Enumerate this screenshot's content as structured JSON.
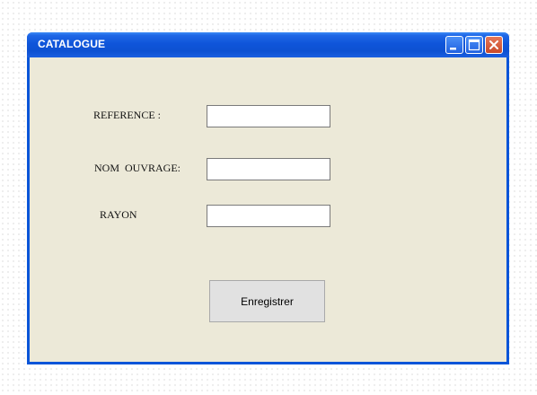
{
  "window": {
    "title": "CATALOGUE",
    "controls": {
      "minimize_icon": "minimize-icon",
      "maximize_icon": "maximize-icon",
      "close_icon": "close-icon"
    }
  },
  "form": {
    "fields": [
      {
        "label": "REFERENCE :",
        "value": "",
        "placeholder": ""
      },
      {
        "label": "NOM  OUVRAGE:",
        "value": "",
        "placeholder": ""
      },
      {
        "label": "RAYON",
        "value": "",
        "placeholder": ""
      }
    ],
    "submit_label": "Enregistrer"
  },
  "colors": {
    "titlebar": "#0f55da",
    "window_border": "#0a55d8",
    "client_area": "#ece9d8",
    "close_button": "#d75a38",
    "button_face": "#e1e1e1"
  }
}
